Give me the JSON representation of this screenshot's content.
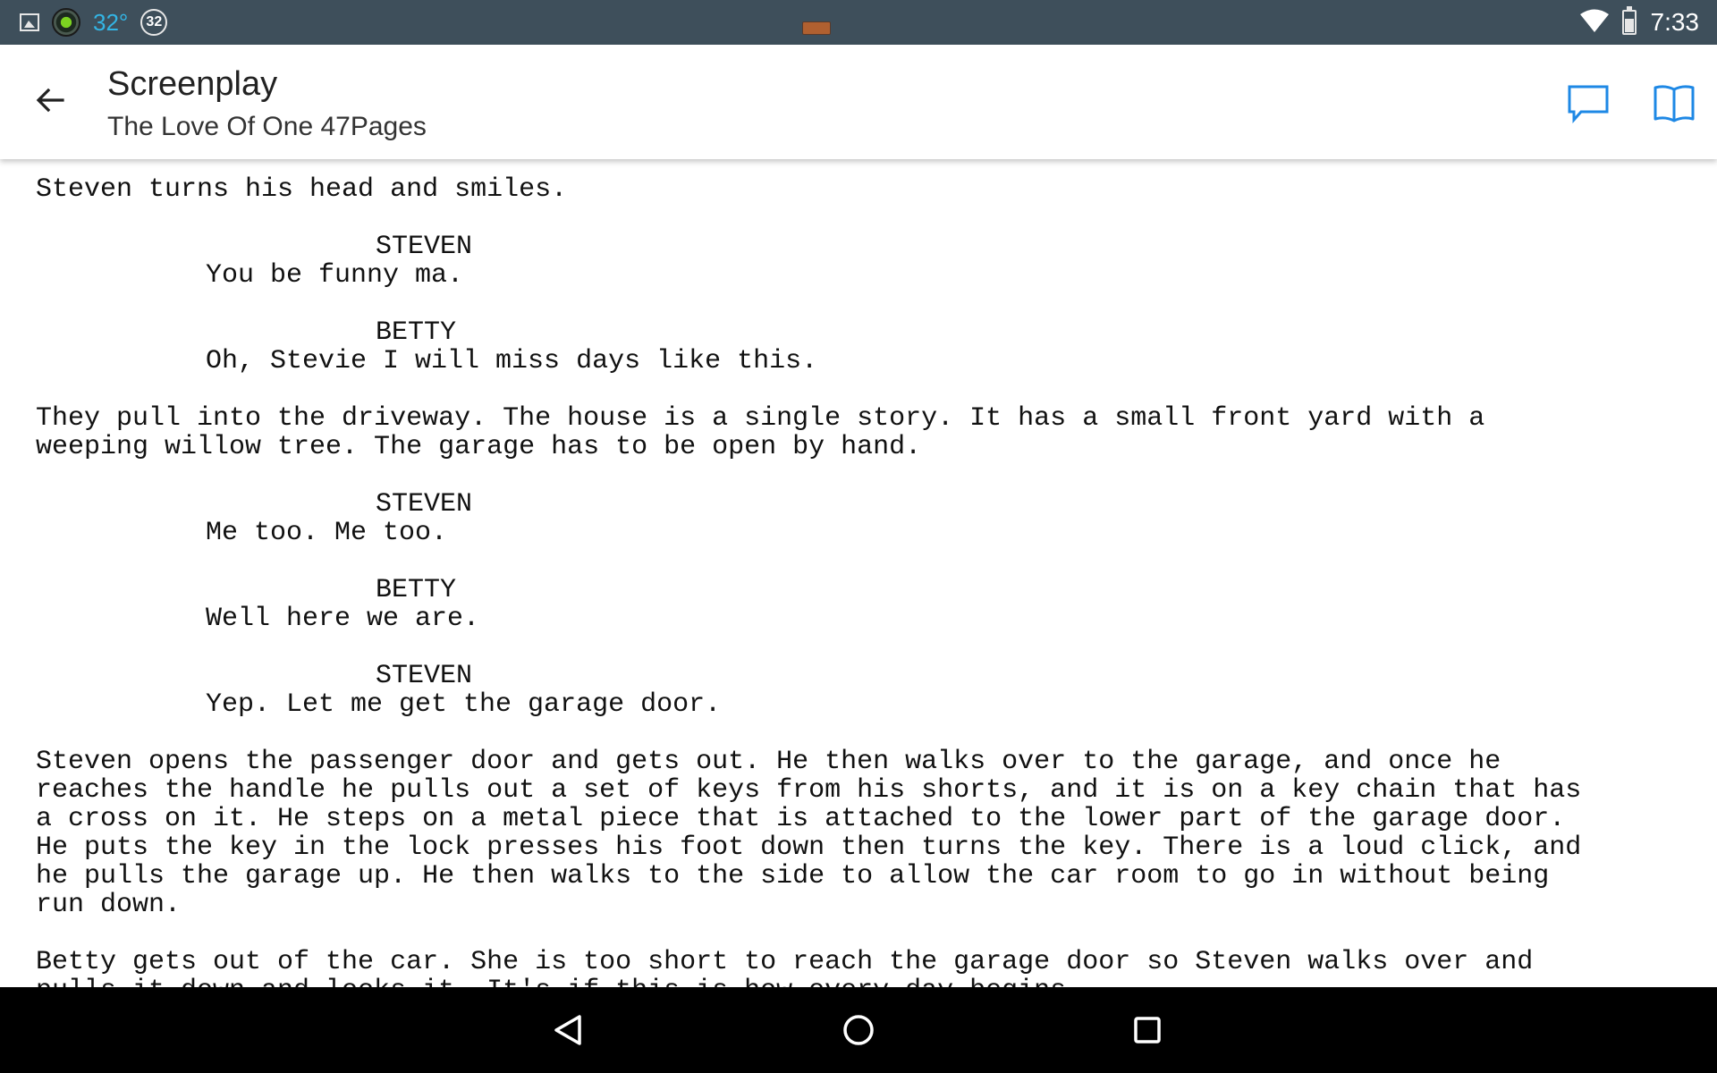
{
  "status_bar": {
    "temperature": "32°",
    "badge": "32",
    "time": "7:33",
    "icons": [
      "image-icon",
      "camera-icon",
      "notification-badge",
      "cast-icon",
      "wifi-icon",
      "battery-icon"
    ]
  },
  "app_bar": {
    "title": "Screenplay",
    "subtitle": "The Love Of One 47Pages",
    "back_icon": "arrow-back-icon",
    "actions": [
      {
        "name": "comment",
        "icon": "comment-icon"
      },
      {
        "name": "read",
        "icon": "book-open-icon"
      }
    ],
    "accent_color": "#1e88e5"
  },
  "script": {
    "lines": [
      {
        "type": "action",
        "text": "Steven turns his head and smiles."
      },
      {
        "type": "gap",
        "text": ""
      },
      {
        "type": "character",
        "text": "STEVEN"
      },
      {
        "type": "dialogue",
        "text": "You be funny ma."
      },
      {
        "type": "gap",
        "text": ""
      },
      {
        "type": "character",
        "text": "BETTY"
      },
      {
        "type": "dialogue",
        "text": "Oh, Stevie I will miss days like this."
      },
      {
        "type": "gap",
        "text": ""
      },
      {
        "type": "action",
        "text": "They pull into the driveway. The house is a single story. It has a small front yard with a"
      },
      {
        "type": "action",
        "text": "weeping willow tree. The garage has to be open by hand."
      },
      {
        "type": "gap",
        "text": ""
      },
      {
        "type": "character",
        "text": "STEVEN"
      },
      {
        "type": "dialogue",
        "text": "Me too. Me too."
      },
      {
        "type": "gap",
        "text": ""
      },
      {
        "type": "character",
        "text": "BETTY"
      },
      {
        "type": "dialogue",
        "text": "Well here we are."
      },
      {
        "type": "gap",
        "text": ""
      },
      {
        "type": "character",
        "text": "STEVEN"
      },
      {
        "type": "dialogue",
        "text": "Yep. Let me get the garage door."
      },
      {
        "type": "gap",
        "text": ""
      },
      {
        "type": "action",
        "text": "Steven opens the passenger door and gets out. He then walks over to the garage, and once he"
      },
      {
        "type": "action",
        "text": "reaches the handle he pulls out a set of keys from his shorts, and it is on a key chain that has"
      },
      {
        "type": "action",
        "text": "a cross on it. He steps on a metal piece that is attached to the lower part of the garage door."
      },
      {
        "type": "action",
        "text": "He puts the key in the lock presses his foot down then turns the key. There is a loud click, and"
      },
      {
        "type": "action",
        "text": "he pulls the garage up. He then walks to the side to allow the car room to go in without being"
      },
      {
        "type": "action",
        "text": "run down."
      },
      {
        "type": "gap",
        "text": ""
      },
      {
        "type": "action",
        "text": "Betty gets out of the car. She is too short to reach the garage door so Steven walks over and"
      },
      {
        "type": "action",
        "text": "pulls it down and locks it. It's if this is how every day begins."
      }
    ]
  },
  "nav_bar": {
    "buttons": [
      {
        "name": "back",
        "icon": "triangle-back-icon"
      },
      {
        "name": "home",
        "icon": "circle-home-icon"
      },
      {
        "name": "recents",
        "icon": "square-recents-icon"
      }
    ]
  }
}
